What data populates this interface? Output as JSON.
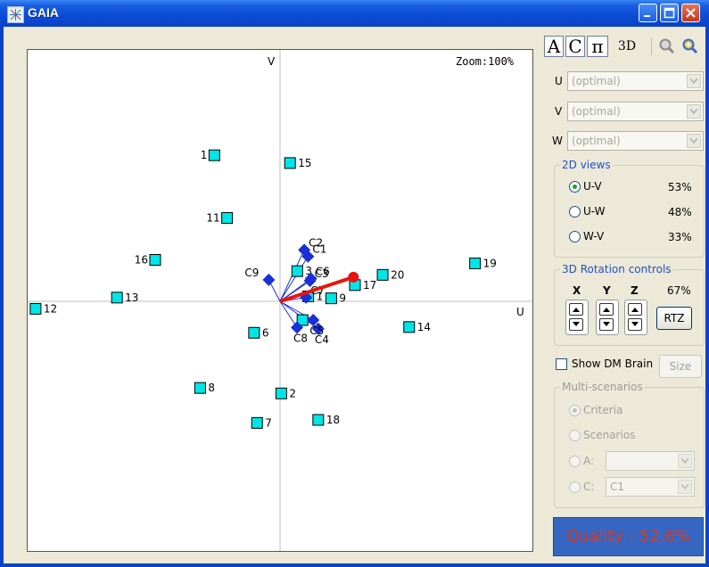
{
  "window": {
    "title": "GAIA"
  },
  "toolbar": {
    "btn_a": "A",
    "btn_c": "C",
    "btn_pi": "π",
    "btn_3d": "3D"
  },
  "plot": {
    "zoom": "Zoom:100%",
    "axis_u_label": "U",
    "axis_v_label": "V",
    "actions": [
      {
        "label": "1",
        "u": -0.263,
        "v": 0.585
      },
      {
        "label": "2",
        "u": 0.005,
        "v": -0.369
      },
      {
        "label": "3",
        "u": 0.069,
        "v": 0.121
      },
      {
        "label": "6",
        "u": -0.104,
        "v": -0.126
      },
      {
        "label": "7",
        "u": -0.092,
        "v": -0.487
      },
      {
        "label": "8",
        "u": -0.32,
        "v": -0.347
      },
      {
        "label": "9",
        "u": 0.205,
        "v": 0.012
      },
      {
        "label": "11",
        "u": -0.212,
        "v": 0.334
      },
      {
        "label": "12",
        "u": -0.979,
        "v": -0.03
      },
      {
        "label": "13",
        "u": -0.653,
        "v": 0.015
      },
      {
        "label": "14",
        "u": 0.517,
        "v": -0.103
      },
      {
        "label": "15",
        "u": 0.04,
        "v": 0.554
      },
      {
        "label": "16",
        "u": -0.5,
        "v": 0.166
      },
      {
        "label": "17",
        "u": 0.3,
        "v": 0.065
      },
      {
        "label": "18",
        "u": 0.153,
        "v": -0.475
      },
      {
        "label": "19",
        "u": 0.781,
        "v": 0.152
      },
      {
        "label": "20",
        "u": 0.411,
        "v": 0.106
      },
      {
        "label": "1",
        "u": 0.113,
        "v": 0.02
      },
      {
        "label": "",
        "u": 0.09,
        "v": -0.075
      }
    ],
    "criteria": [
      {
        "label": "C1",
        "u": 0.112,
        "v": 0.18
      },
      {
        "label": "C2",
        "u": 0.097,
        "v": 0.206
      },
      {
        "label": "C3",
        "u": 0.12,
        "v": 0.082
      },
      {
        "label": "C4",
        "u": 0.153,
        "v": -0.11
      },
      {
        "label": "C5",
        "u": 0.133,
        "v": -0.075
      },
      {
        "label": "C6",
        "u": 0.124,
        "v": 0.091
      },
      {
        "label": "C7",
        "u": 0.104,
        "v": 0.015
      },
      {
        "label": "C8",
        "u": 0.068,
        "v": -0.105
      },
      {
        "label": "C9",
        "u": -0.045,
        "v": 0.086
      }
    ],
    "decision_axis": {
      "u": 0.294,
      "v": 0.097
    }
  },
  "projection": {
    "u_label": "U",
    "u_value": "(optimal)",
    "v_label": "V",
    "v_value": "(optimal)",
    "w_label": "W",
    "w_value": "(optimal)"
  },
  "views_2d": {
    "title": "2D views",
    "items": [
      {
        "label": "U-V",
        "pct": "53%",
        "selected": true
      },
      {
        "label": "U-W",
        "pct": "48%",
        "selected": false
      },
      {
        "label": "W-V",
        "pct": "33%",
        "selected": false
      }
    ]
  },
  "rotation": {
    "title": "3D Rotation controls",
    "x_label": "X",
    "y_label": "Y",
    "z_label": "Z",
    "pct": "67%",
    "rtz_label": "RTZ"
  },
  "dm_brain": {
    "label": "Show DM Brain",
    "checked": false,
    "size_label": "Size"
  },
  "multi_scenarios": {
    "title": "Multi-scenarios",
    "criteria_label": "Criteria",
    "scenarios_label": "Scenarios",
    "a_label": "A:",
    "a_value": "",
    "c_label": "C:",
    "c_value": "C1"
  },
  "quality": {
    "text": "Quality : 52.6%"
  },
  "colors": {
    "action_fill": "#00e5e5",
    "criterion": "#1a2fd6",
    "decision_axis": "#e8140f",
    "quality_bg": "#3567c2"
  }
}
